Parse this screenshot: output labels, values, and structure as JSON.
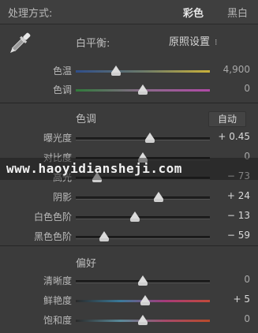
{
  "header": {
    "title": "处理方式:",
    "mode_color": "彩色",
    "mode_bw": "黑白"
  },
  "white_balance": {
    "title": "白平衡:",
    "preset_label": "原照设置",
    "temp": {
      "label": "色温",
      "value": "4,900",
      "level": 0.3
    },
    "tint": {
      "label": "色调",
      "value": "0",
      "level": 0.5
    }
  },
  "tone": {
    "title": "色调",
    "auto_label": "自动",
    "rows": [
      {
        "label": "曝光度",
        "value": "+ 0.45",
        "level": 0.55,
        "lit": true
      },
      {
        "label": "对比度",
        "value": "0",
        "level": 0.5,
        "lit": false
      },
      {
        "label": "高光",
        "value": "− 73",
        "level": 0.16,
        "lit": true
      },
      {
        "label": "阴影",
        "value": "+ 24",
        "level": 0.62,
        "lit": true
      },
      {
        "label": "白色色阶",
        "value": "− 13",
        "level": 0.44,
        "lit": true
      },
      {
        "label": "黑色色阶",
        "value": "− 59",
        "level": 0.21,
        "lit": true
      }
    ]
  },
  "presence": {
    "title": "偏好",
    "rows": [
      {
        "label": "清晰度",
        "value": "0",
        "level": 0.5,
        "lit": false
      },
      {
        "label": "鲜艳度",
        "value": "+ 5",
        "level": 0.52,
        "lit": true
      },
      {
        "label": "饱和度",
        "value": "0",
        "level": 0.5,
        "lit": false
      }
    ]
  },
  "watermark": {
    "text": "www.haoyidiansheji.com"
  }
}
